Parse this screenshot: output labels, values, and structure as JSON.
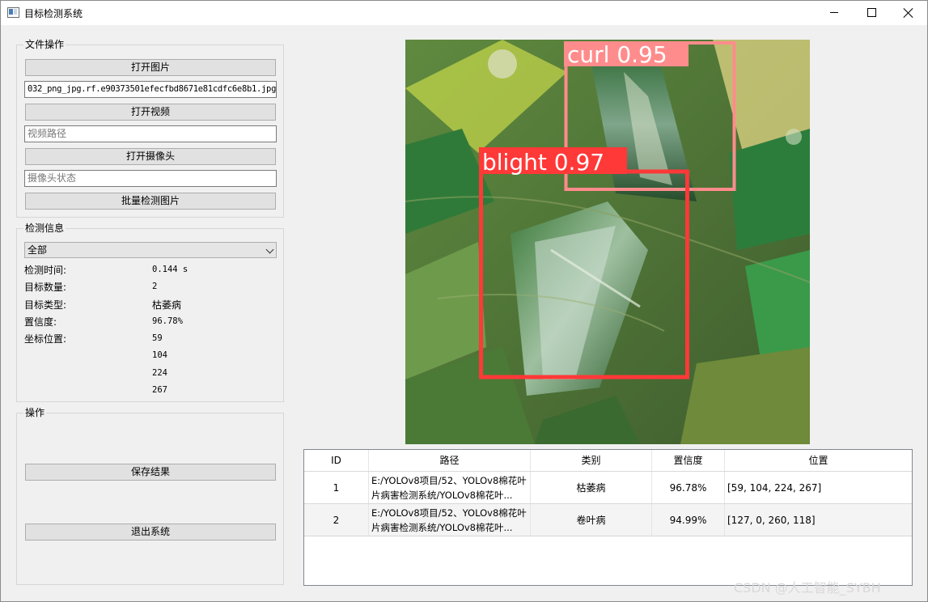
{
  "window": {
    "title": "目标检测系统"
  },
  "file_ops": {
    "group_title": "文件操作",
    "open_image_label": "打开图片",
    "image_path_value": "032_png_jpg.rf.e90373501efecfbd8671e81cdfc6e8b1.jpg",
    "open_video_label": "打开视频",
    "video_path_placeholder": "视频路径",
    "open_camera_label": "打开摄像头",
    "camera_status_placeholder": "摄像头状态",
    "batch_detect_label": "批量检测图片"
  },
  "detect_info": {
    "group_title": "检测信息",
    "selector_value": "全部",
    "time_label": "检测时间:",
    "time_value": "0.144 s",
    "count_label": "目标数量:",
    "count_value": "2",
    "type_label": "目标类型:",
    "type_value": "枯萎病",
    "conf_label": "置信度:",
    "conf_value": "96.78%",
    "pos_label": "坐标位置:",
    "pos_values": [
      "59",
      "104",
      "224",
      "267"
    ]
  },
  "actions": {
    "group_title": "操作",
    "save_label": "保存结果",
    "exit_label": "退出系统"
  },
  "detections": [
    {
      "label": "curl 0.95",
      "color": "#ff8c8c"
    },
    {
      "label": "blight 0.97",
      "color": "#ff3838"
    }
  ],
  "table": {
    "headers": [
      "ID",
      "路径",
      "类别",
      "置信度",
      "位置"
    ],
    "rows": [
      {
        "id": "1",
        "path": "E:/YOLOv8项目/52、YOLOv8棉花叶片病害检测系统/YOLOv8棉花叶...",
        "category": "枯萎病",
        "confidence": "96.78%",
        "position": "[59, 104, 224, 267]"
      },
      {
        "id": "2",
        "path": "E:/YOLOv8项目/52、YOLOv8棉花叶片病害检测系统/YOLOv8棉花叶...",
        "category": "卷叶病",
        "confidence": "94.99%",
        "position": "[127, 0, 260, 118]"
      }
    ]
  },
  "watermark": "CSDN @人工智能_SYBH"
}
